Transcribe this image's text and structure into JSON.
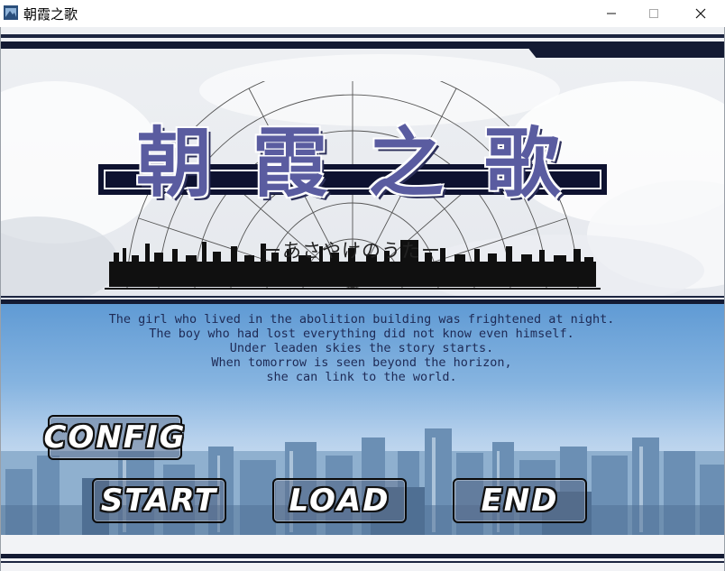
{
  "window": {
    "title": "朝霞之歌",
    "icon": "game-app-icon",
    "controls": [
      "minimize-icon",
      "maximize-icon",
      "close-icon"
    ]
  },
  "logo": {
    "title_chars": [
      "朝",
      "霞",
      "之",
      "歌"
    ],
    "subtitle": "ーあさやけのうたー"
  },
  "story": {
    "lines": [
      "The girl who lived in the abolition building was frightened at night.",
      "The boy who had lost everything did not know even himself.",
      "Under leaden skies the story starts.",
      "",
      "When tomorrow is seen beyond the horizon,",
      "she can link to the world."
    ]
  },
  "menu": {
    "config_label": "CONFIG",
    "start_label": "START",
    "load_label": "LOAD",
    "end_label": "END"
  },
  "colors": {
    "band": "#131a33",
    "logo_text": "#5a5ca0",
    "story_text": "#1e2a55",
    "sky_top": "#5f9ad4"
  }
}
